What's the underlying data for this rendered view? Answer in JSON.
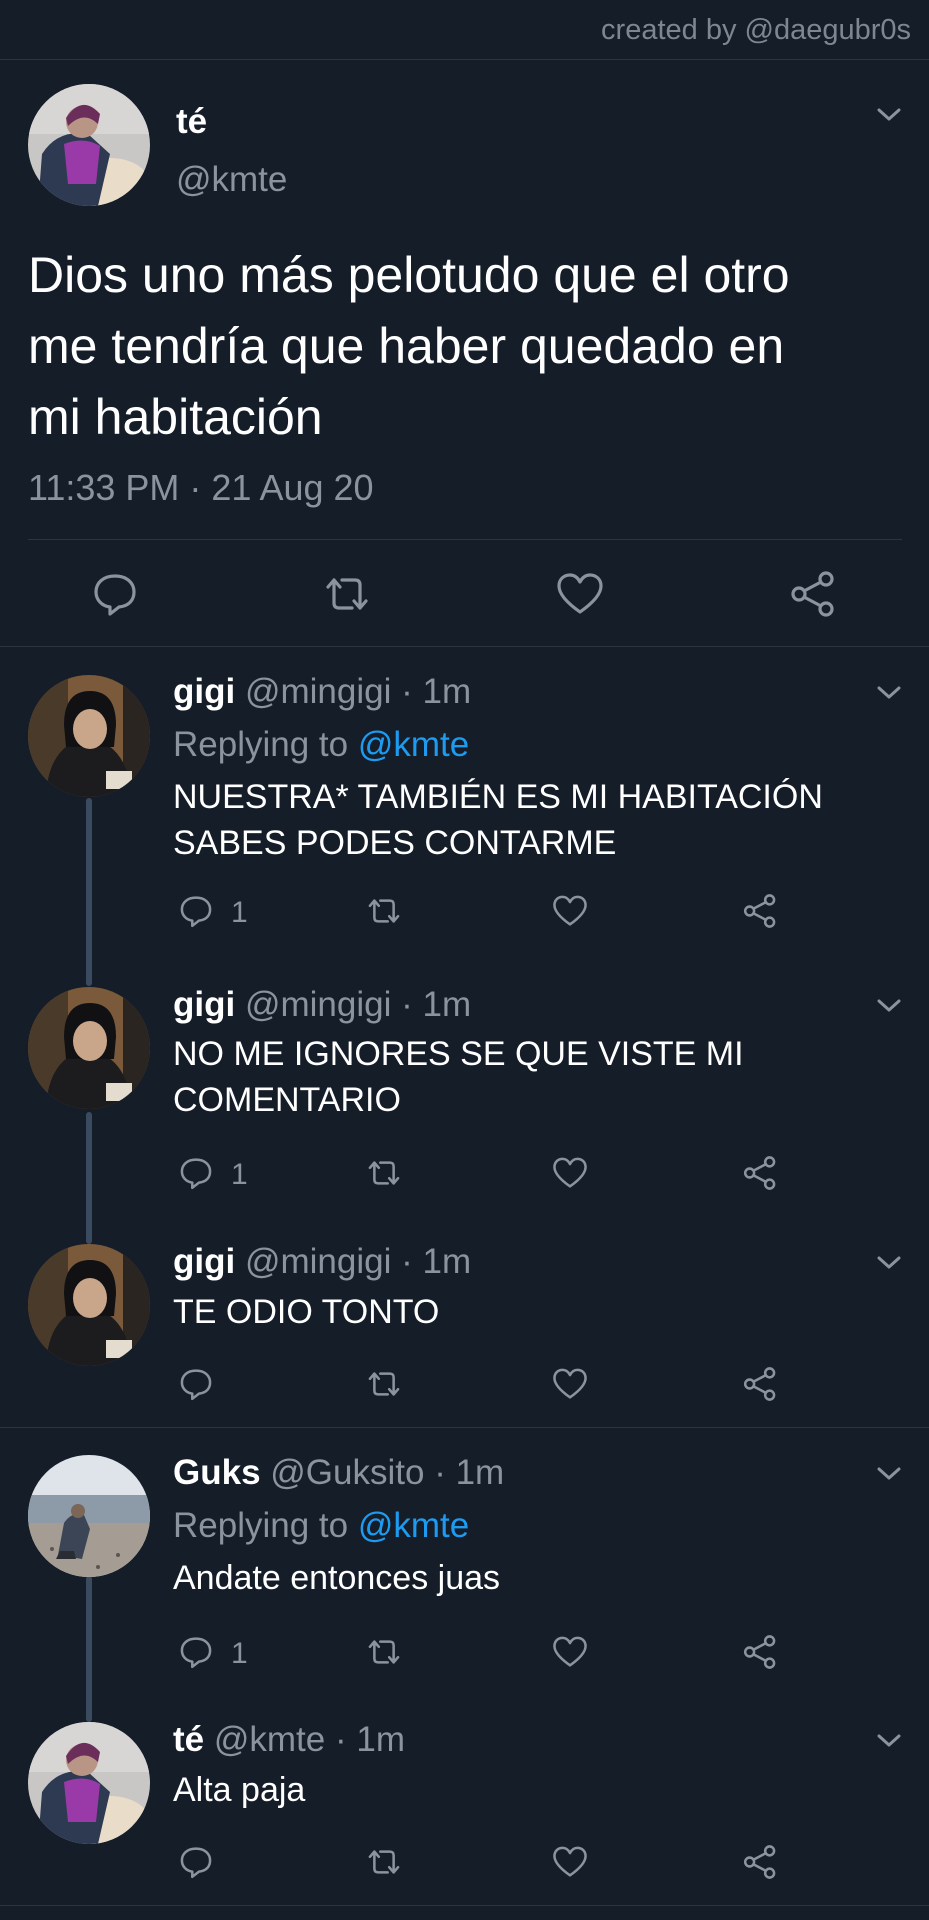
{
  "credit": "created by @daegubr0s",
  "main_tweet": {
    "name": "té",
    "handle": "@kmte",
    "text_lines": [
      "Dios uno más pelotudo que el otro",
      "me tendría que haber quedado en",
      "mi habitación"
    ],
    "timestamp": "11:33 PM · 21 Aug 20"
  },
  "replies": [
    {
      "name": "gigi",
      "handle": "@mingigi",
      "time": "· 1m",
      "replying_prefix": "Replying to ",
      "replying_to": "@kmte",
      "text_lines": [
        "NUESTRA* TAMBIÉN ES MI HABITACIÓN",
        "SABES PODES CONTARME"
      ],
      "reply_count": "1",
      "avatar": "hooded"
    },
    {
      "name": "gigi",
      "handle": "@mingigi",
      "time": "· 1m",
      "replying_prefix": "",
      "replying_to": "",
      "text_lines": [
        "NO ME IGNORES SE QUE VISTE MI",
        "COMENTARIO"
      ],
      "reply_count": "1",
      "avatar": "hooded"
    },
    {
      "name": "gigi",
      "handle": "@mingigi",
      "time": "· 1m",
      "replying_prefix": "",
      "replying_to": "",
      "text_lines": [
        "TE ODIO TONTO"
      ],
      "reply_count": "",
      "avatar": "hooded"
    },
    {
      "name": "Guks",
      "handle": "@Guksito",
      "time": "· 1m",
      "replying_prefix": "Replying to ",
      "replying_to": "@kmte",
      "text_lines": [
        "Andate entonces juas"
      ],
      "reply_count": "1",
      "avatar": "beach"
    },
    {
      "name": "té",
      "handle": "@kmte",
      "time": "· 1m",
      "replying_prefix": "",
      "replying_to": "",
      "text_lines": [
        "Alta paja"
      ],
      "reply_count": "",
      "avatar": "purple"
    }
  ],
  "icons": {
    "reply": "reply-bubble-icon",
    "retweet": "retweet-icon",
    "like": "heart-icon",
    "share": "share-icon",
    "more": "chevron-down-icon"
  },
  "colors": {
    "background": "#151d29",
    "link": "#1d9bf0",
    "muted": "#8b949e",
    "thread_line": "#3a4a5f"
  }
}
